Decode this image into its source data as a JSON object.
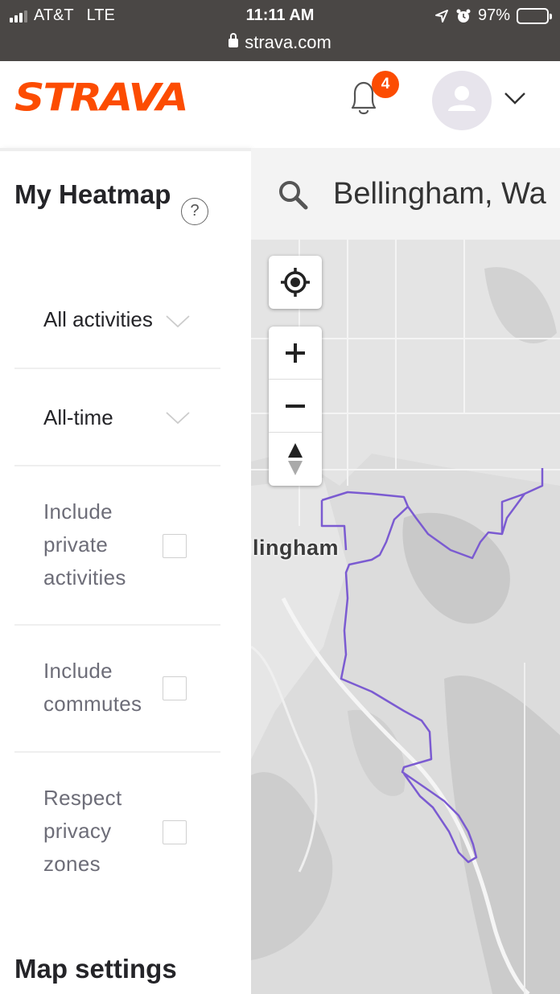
{
  "status_bar": {
    "carrier": "AT&T",
    "network": "LTE",
    "time": "11:11 AM",
    "battery": "97%",
    "url": "strava.com"
  },
  "header": {
    "logo": "STRAVA",
    "notification_count": "4",
    "icons": [
      "bell-icon",
      "avatar-icon",
      "chevron-down-icon"
    ]
  },
  "sidebar": {
    "title": "My Heatmap",
    "help_icon": "?",
    "activity_filter": "All activities",
    "time_filter": "All-time",
    "options": [
      {
        "label": "Include private activities",
        "checked": false
      },
      {
        "label": "Include commutes",
        "checked": false
      },
      {
        "label": "Respect privacy zones",
        "checked": false
      }
    ],
    "map_settings_title": "Map settings"
  },
  "map": {
    "search_value": "Bellingham, Wa",
    "city_label": "llingham",
    "controls": [
      "locate-icon",
      "zoom-in-icon",
      "zoom-out-icon",
      "compass-icon"
    ],
    "route_color": "#7b5bd1"
  },
  "colors": {
    "brand": "#fc4c02",
    "badge": "#fc4c02"
  }
}
